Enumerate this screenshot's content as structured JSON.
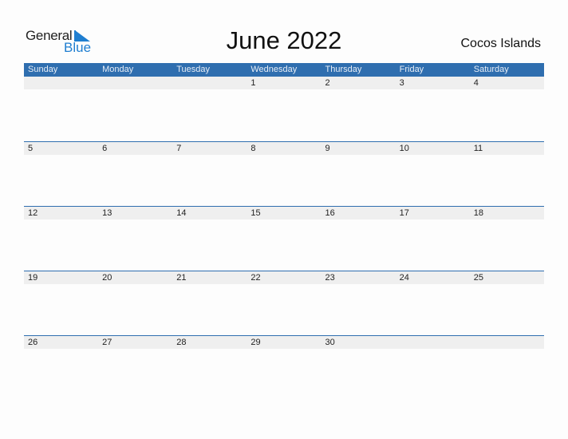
{
  "logo": {
    "general": "General",
    "blue": "Blue"
  },
  "title": "June 2022",
  "region": "Cocos Islands",
  "colors": {
    "header_bg": "#2f6eaf",
    "date_strip_bg": "#efefef",
    "logo_blue": "#1f7ed0"
  },
  "weekdays": [
    "Sunday",
    "Monday",
    "Tuesday",
    "Wednesday",
    "Thursday",
    "Friday",
    "Saturday"
  ],
  "weeks": [
    [
      "",
      "",
      "",
      "1",
      "2",
      "3",
      "4"
    ],
    [
      "5",
      "6",
      "7",
      "8",
      "9",
      "10",
      "11"
    ],
    [
      "12",
      "13",
      "14",
      "15",
      "16",
      "17",
      "18"
    ],
    [
      "19",
      "20",
      "21",
      "22",
      "23",
      "24",
      "25"
    ],
    [
      "26",
      "27",
      "28",
      "29",
      "30",
      "",
      ""
    ]
  ]
}
